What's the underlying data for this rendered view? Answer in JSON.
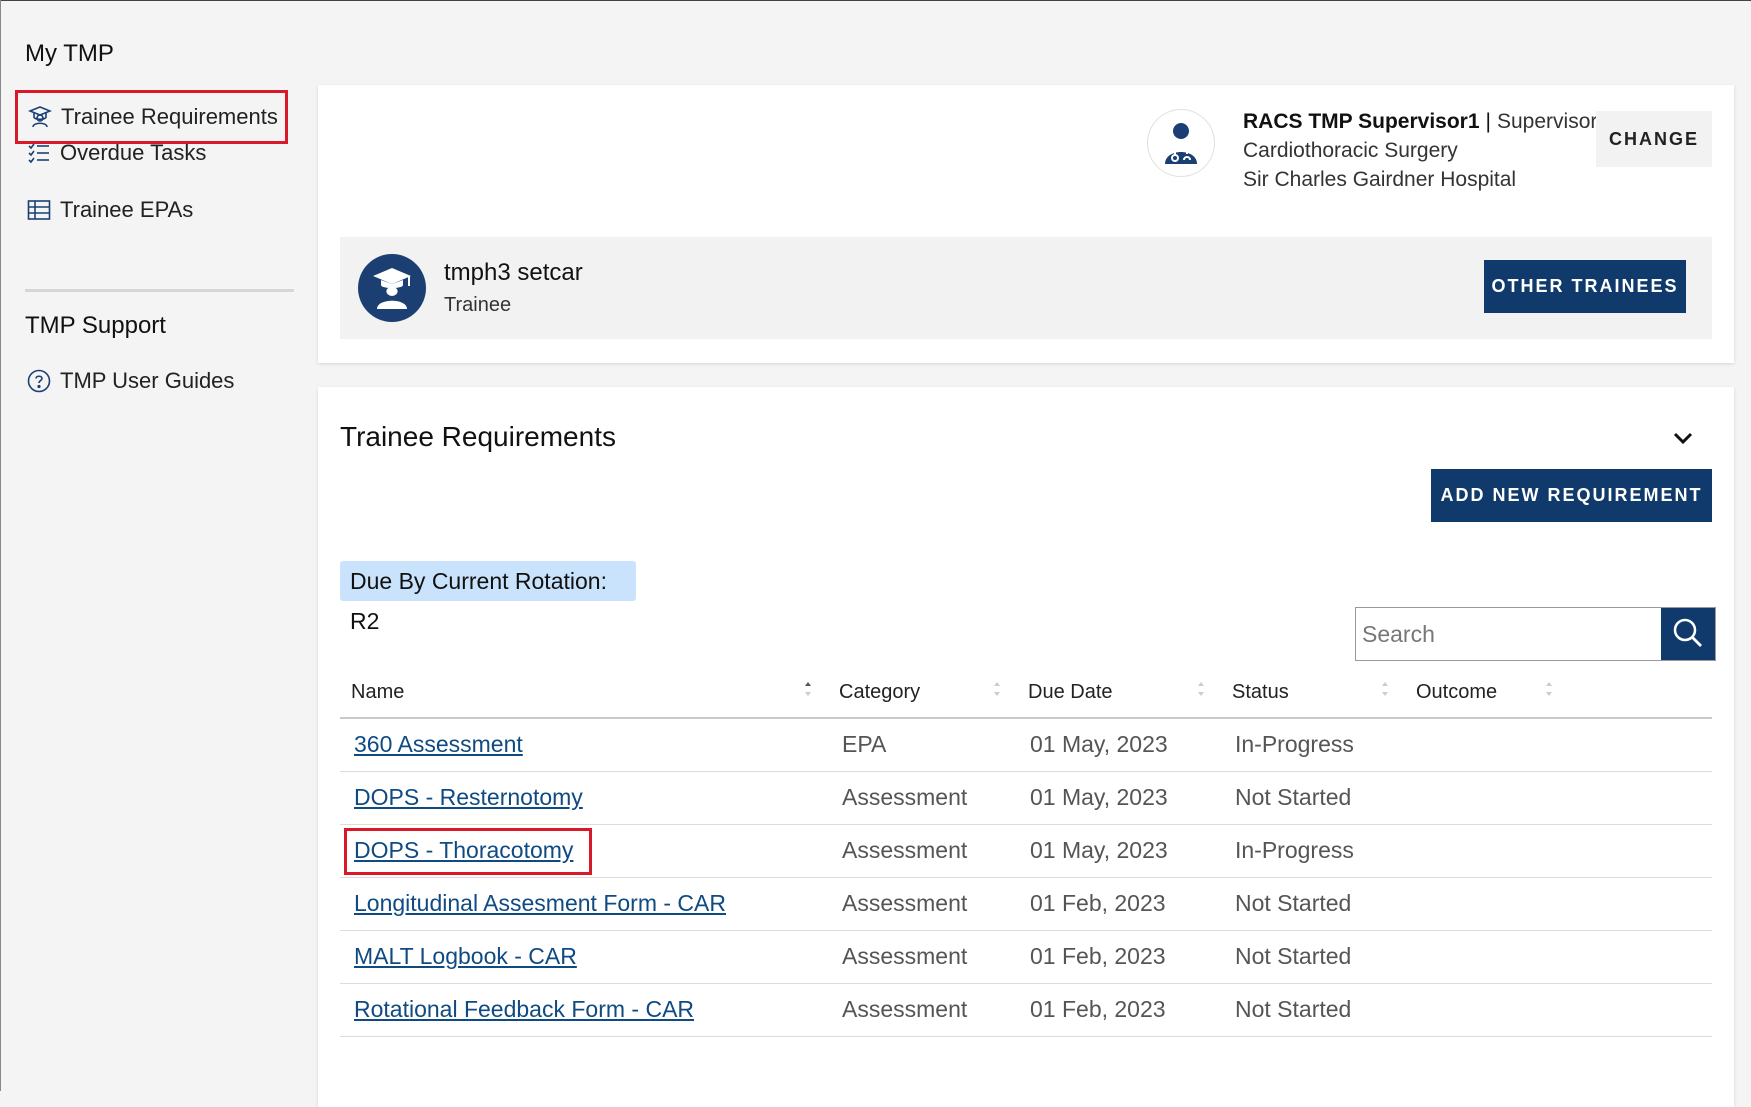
{
  "sidebar": {
    "section1_title": "My TMP",
    "items": [
      {
        "label": "Trainee Requirements",
        "icon": "graduation-cap-icon"
      },
      {
        "label": "Overdue Tasks",
        "icon": "checklist-icon"
      },
      {
        "label": "Trainee EPAs",
        "icon": "table-grid-icon"
      }
    ],
    "section2_title": "TMP Support",
    "support_items": [
      {
        "label": "TMP User Guides",
        "icon": "question-circle-icon"
      }
    ]
  },
  "supervisor": {
    "name": "RACS TMP Supervisor1",
    "separator": "|",
    "role": "Supervisor",
    "specialty": "Cardiothoracic Surgery",
    "hospital": "Sir Charles Gairdner Hospital",
    "change_label": "CHANGE",
    "avatar_icon": "doctor-icon"
  },
  "trainee": {
    "name": "tmph3 setcar",
    "role": "Trainee",
    "other_label": "OTHER TRAINEES",
    "avatar_icon": "graduate-icon"
  },
  "requirements": {
    "title": "Trainee Requirements",
    "add_label": "ADD NEW REQUIREMENT",
    "due_label": "Due By Current Rotation:",
    "due_value": "R2",
    "search_placeholder": "Search",
    "columns": [
      "Name",
      "Category",
      "Due Date",
      "Status",
      "Outcome"
    ],
    "rows": [
      {
        "name": "360 Assessment",
        "category": "EPA",
        "due": "01 May, 2023",
        "status": "In-Progress",
        "outcome": ""
      },
      {
        "name": "DOPS - Resternotomy",
        "category": "Assessment",
        "due": "01 May, 2023",
        "status": "Not Started",
        "outcome": ""
      },
      {
        "name": "DOPS - Thoracotomy",
        "category": "Assessment",
        "due": "01 May, 2023",
        "status": "In-Progress",
        "outcome": ""
      },
      {
        "name": "Longitudinal Assesment Form - CAR",
        "category": "Assessment",
        "due": "01 Feb, 2023",
        "status": "Not Started",
        "outcome": ""
      },
      {
        "name": "MALT Logbook - CAR",
        "category": "Assessment",
        "due": "01 Feb, 2023",
        "status": "Not Started",
        "outcome": ""
      },
      {
        "name": "Rotational Feedback Form - CAR",
        "category": "Assessment",
        "due": "01 Feb, 2023",
        "status": "Not Started",
        "outcome": ""
      }
    ]
  },
  "colors": {
    "primary": "#0f3a6b",
    "highlight": "#d9192a",
    "badge": "#c8e3fb",
    "link": "#0f4a82"
  }
}
